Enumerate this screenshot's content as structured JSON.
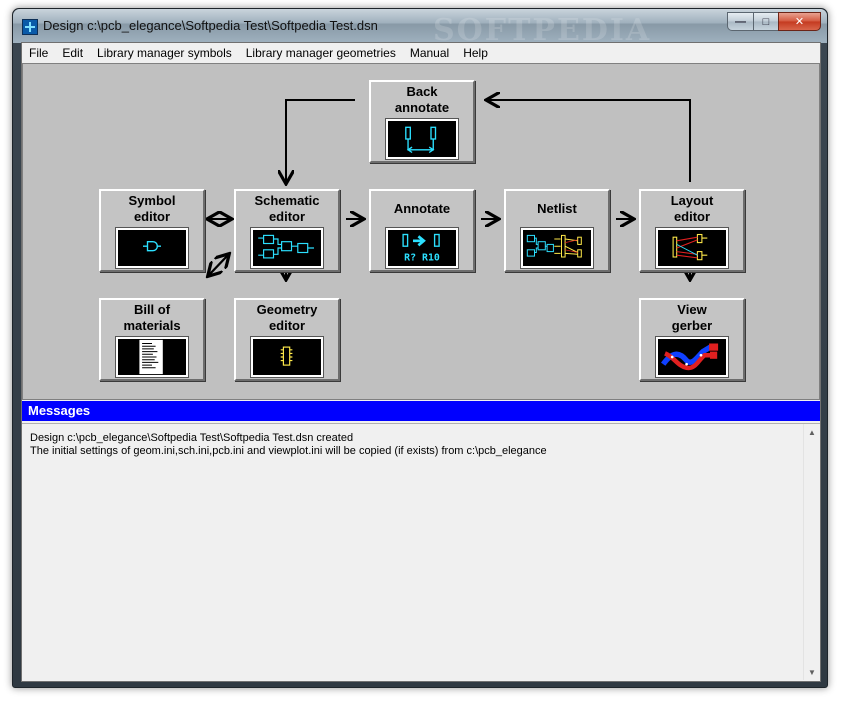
{
  "window": {
    "title": "Design c:\\pcb_elegance\\Softpedia Test\\Softpedia Test.dsn",
    "controls": {
      "minimize": "—",
      "maximize": "□",
      "close": "✕"
    }
  },
  "watermark": "SOFTPEDIA",
  "menu": [
    "File",
    "Edit",
    "Library manager symbols",
    "Library manager geometries",
    "Manual",
    "Help"
  ],
  "tools": {
    "back_annotate": {
      "line1": "Back",
      "line2": "annotate",
      "icon": "back-annotate-picture"
    },
    "symbol_editor": {
      "line1": "Symbol",
      "line2": "editor",
      "icon": "gate-symbol-picture"
    },
    "schematic_editor": {
      "line1": "Schematic",
      "line2": "editor",
      "icon": "schematic-picture"
    },
    "annotate": {
      "line1": "Annotate",
      "line2": "",
      "icon": "annotate-picture",
      "pic_text": "R? R10"
    },
    "netlist": {
      "line1": "Netlist",
      "line2": "",
      "icon": "netlist-picture"
    },
    "layout_editor": {
      "line1": "Layout",
      "line2": "editor",
      "icon": "layout-picture"
    },
    "bill_of_materials": {
      "line1": "Bill of",
      "line2": "materials",
      "icon": "document-picture"
    },
    "geometry_editor": {
      "line1": "Geometry",
      "line2": "editor",
      "icon": "footprint-picture"
    },
    "view_gerber": {
      "line1": "View",
      "line2": "gerber",
      "icon": "gerber-picture"
    }
  },
  "messages": {
    "header": "Messages",
    "lines": [
      "Design c:\\pcb_elegance\\Softpedia Test\\Softpedia Test.dsn created",
      "The initial settings of geom.ini,sch.ini,pcb.ini and viewplot.ini will be copied (if exists) from c:\\pcb_elegance"
    ]
  },
  "colors": {
    "desktop_bg": "#c0c0c0",
    "messages_bar": "#0000ff",
    "icon_cyan": "#2ce0ff",
    "icon_yellow": "#ffe94a",
    "gerber_red": "#e02020",
    "gerber_blue": "#1040ff"
  }
}
